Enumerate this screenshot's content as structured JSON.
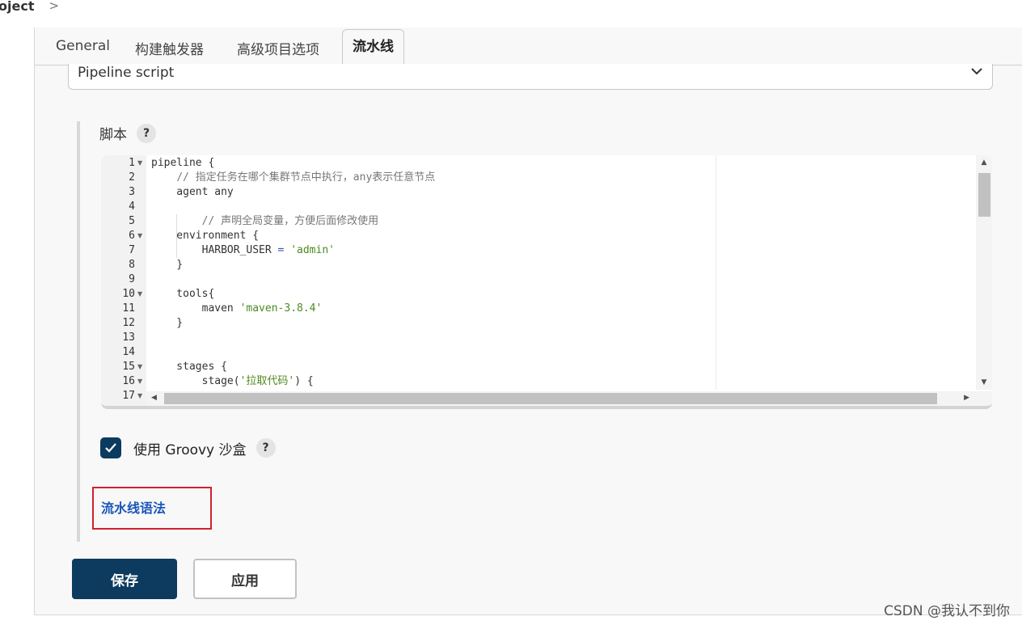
{
  "breadcrumb": {
    "item": "oject",
    "separator": ">"
  },
  "tabs": [
    {
      "label": "General"
    },
    {
      "label": "构建触发器"
    },
    {
      "label": "高级项目选项"
    },
    {
      "label": "流水线",
      "active": true
    }
  ],
  "definition_select": {
    "value": "Pipeline script"
  },
  "script": {
    "label": "脚本",
    "help": "?",
    "lines": [
      {
        "n": "1",
        "fold": true,
        "text": "pipeline {"
      },
      {
        "n": "2",
        "fold": false,
        "text": "    // 指定任务在哪个集群节点中执行，any表示任意节点"
      },
      {
        "n": "3",
        "fold": false,
        "text": "    agent any"
      },
      {
        "n": "4",
        "fold": false,
        "text": ""
      },
      {
        "n": "5",
        "fold": false,
        "text": "        // 声明全局变量，方便后面修改使用"
      },
      {
        "n": "6",
        "fold": true,
        "text": "    environment {"
      },
      {
        "n": "7",
        "fold": false,
        "text": "        HARBOR_USER = 'admin'"
      },
      {
        "n": "8",
        "fold": false,
        "text": "    }"
      },
      {
        "n": "9",
        "fold": false,
        "text": ""
      },
      {
        "n": "10",
        "fold": true,
        "text": "    tools{"
      },
      {
        "n": "11",
        "fold": false,
        "text": "        maven 'maven-3.8.4'"
      },
      {
        "n": "12",
        "fold": false,
        "text": "    }"
      },
      {
        "n": "13",
        "fold": false,
        "text": ""
      },
      {
        "n": "14",
        "fold": false,
        "text": ""
      },
      {
        "n": "15",
        "fold": true,
        "text": "    stages {"
      },
      {
        "n": "16",
        "fold": true,
        "text": "        stage('拉取代码') {"
      },
      {
        "n": "17",
        "fold": true,
        "text": ""
      }
    ]
  },
  "sandbox": {
    "label": "使用 Groovy 沙盒",
    "checked": true,
    "help": "?"
  },
  "syntax_link": "流水线语法",
  "buttons": {
    "save": "保存",
    "apply": "应用"
  },
  "watermark": "CSDN @我认不到你",
  "colors": {
    "primary": "#0d3b5f",
    "link": "#1a56b8",
    "highlight_box": "#d2202a",
    "string": "#4d8a1f",
    "comment": "#777777"
  }
}
